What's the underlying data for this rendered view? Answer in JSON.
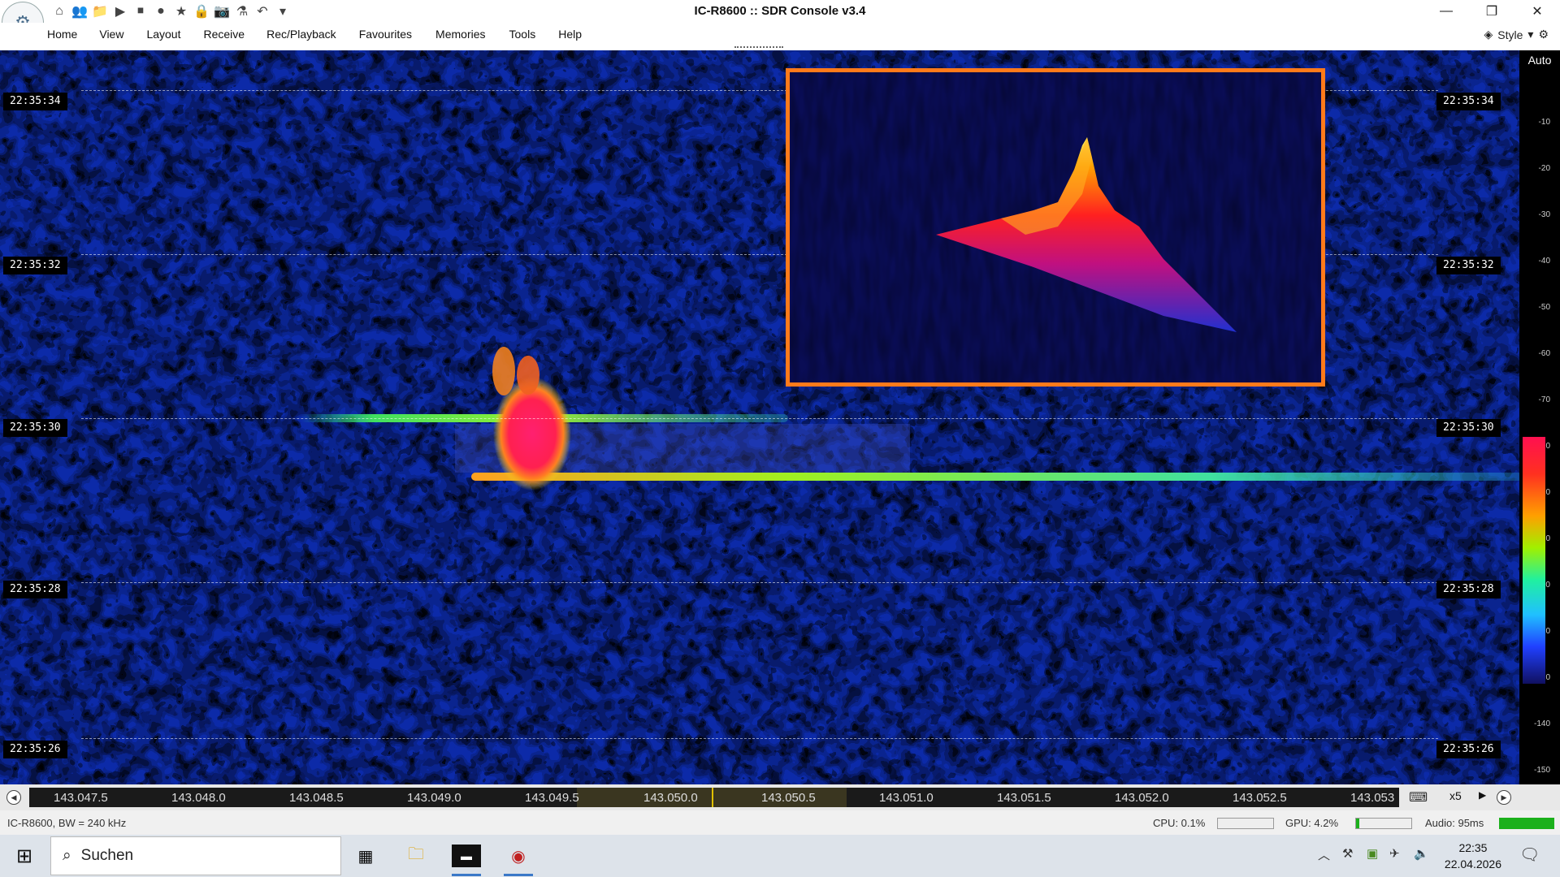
{
  "window": {
    "title": "IC-R8600 :: SDR Console v3.4",
    "minimize": "—",
    "restore": "❐",
    "close": "✕"
  },
  "menu": [
    "Home",
    "View",
    "Layout",
    "Receive",
    "Rec/Playback",
    "Favourites",
    "Memories",
    "Tools",
    "Help"
  ],
  "style_menu": {
    "label": "Style"
  },
  "waterfall": {
    "time_labels": [
      "22:35:34",
      "22:35:32",
      "22:35:30",
      "22:35:28",
      "22:35:26"
    ]
  },
  "level_scale": {
    "mode": "Auto",
    "ticks": [
      "-10",
      "-20",
      "-30",
      "-40",
      "-50",
      "-60",
      "-70",
      "-80",
      "-90",
      "-100",
      "-110",
      "-120",
      "-130",
      "-140",
      "-150"
    ]
  },
  "frequency_axis": {
    "labels": [
      "143.047.5",
      "143.048.0",
      "143.048.5",
      "143.049.0",
      "143.049.5",
      "143.050.0",
      "143.050.5",
      "143.051.0",
      "143.051.5",
      "143.052.0",
      "143.052.5",
      "143.053"
    ],
    "zoom": "x5"
  },
  "status": {
    "radio": "IC-R8600, BW = 240 kHz",
    "cpu": "CPU: 0.1%",
    "gpu": "GPU: 4.2%",
    "audio": "Audio: 95ms"
  },
  "taskbar": {
    "search_placeholder": "Suchen",
    "time": "22:35",
    "date": "22.04.2026"
  },
  "colors": {
    "accent_orange": "#ff7a1a",
    "audio_meter": "#1bb01b",
    "waterfall_bg": "#0a1a80"
  }
}
